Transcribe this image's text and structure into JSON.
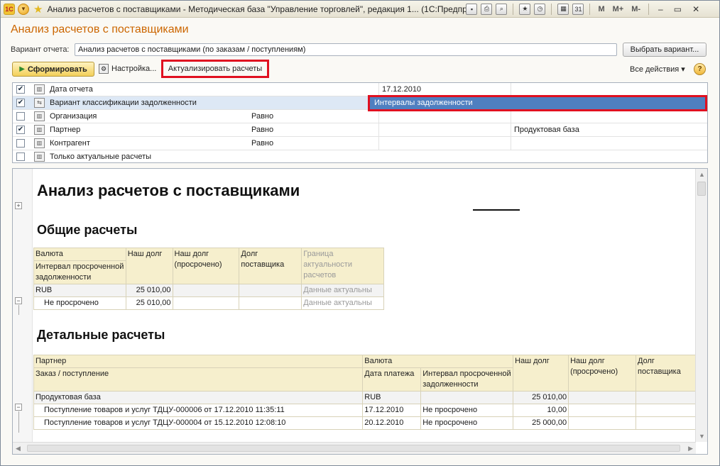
{
  "titlebar": {
    "logo": "1С",
    "title": "Анализ расчетов с поставщиками - Методическая база \"Управление торговлей\", редакция 1... (1С:Предприятие)",
    "m_labels": [
      "M",
      "M+",
      "M-"
    ]
  },
  "page": {
    "title": "Анализ расчетов с поставщиками",
    "variant_label": "Вариант отчета:",
    "variant_value": "Анализ расчетов с поставщиками (по заказам / поступлениям)",
    "choose_variant": "Выбрать вариант..."
  },
  "toolbar": {
    "generate": "Сформировать",
    "settings": "Настройка...",
    "actualize": "Актуализировать расчеты",
    "all_actions": "Все действия",
    "help": "?"
  },
  "settings": {
    "rows": [
      {
        "checked": true,
        "name": "Дата отчета",
        "condition": "",
        "value": "17.12.2010",
        "extra": ""
      },
      {
        "checked": true,
        "name": "Вариант классификации задолженности",
        "condition": "",
        "value": "Интервалы задолженности",
        "extra": ""
      },
      {
        "checked": false,
        "name": "Организация",
        "condition": "Равно",
        "value": "",
        "extra": ""
      },
      {
        "checked": true,
        "name": "Партнер",
        "condition": "Равно",
        "value": "",
        "extra": "Продуктовая база"
      },
      {
        "checked": false,
        "name": "Контрагент",
        "condition": "Равно",
        "value": "",
        "extra": ""
      },
      {
        "checked": false,
        "name": "Только актуальные расчеты",
        "condition": "",
        "value": "",
        "extra": ""
      }
    ]
  },
  "report": {
    "title": "Анализ расчетов с поставщиками",
    "general_heading": "Общие расчеты",
    "general_headers": {
      "currency": "Валюта",
      "interval": "Интервал просроченной задолженности",
      "our_debt": "Наш долг",
      "our_debt_overdue": "Наш долг (просрочено)",
      "supplier_debt": "Долг поставщика",
      "actuality": "Граница актуальности расчетов"
    },
    "general_rows": [
      {
        "label": "RUB",
        "our_debt": "25 010,00",
        "overdue": "",
        "supplier": "",
        "actuality": "Данные актуальны"
      },
      {
        "label": "Не просрочено",
        "our_debt": "25 010,00",
        "overdue": "",
        "supplier": "",
        "actuality": "Данные актуальны"
      }
    ],
    "detail_heading": "Детальные расчеты",
    "detail_headers": {
      "partner": "Партнер",
      "order": "Заказ / поступление",
      "currency": "Валюта",
      "pay_date": "Дата платежа",
      "interval": "Интервал просроченной задолженности",
      "our_debt": "Наш долг",
      "our_debt_overdue": "Наш долг (просрочено)",
      "supplier_debt": "Долг поставщика"
    },
    "detail_rows": [
      {
        "partner": "Продуктовая база",
        "currency": "RUB",
        "interval": "",
        "our_debt": "25 010,00"
      },
      {
        "partner": "Поступление товаров и услуг ТДЦУ-000006 от 17.12.2010 11:35:11",
        "currency": "17.12.2010",
        "interval": "Не просрочено",
        "our_debt": "10,00"
      },
      {
        "partner": "Поступление товаров и услуг ТДЦУ-000004 от 15.12.2010 12:08:10",
        "currency": "20.12.2010",
        "interval": "Не просрочено",
        "our_debt": "25 000,00"
      }
    ]
  }
}
